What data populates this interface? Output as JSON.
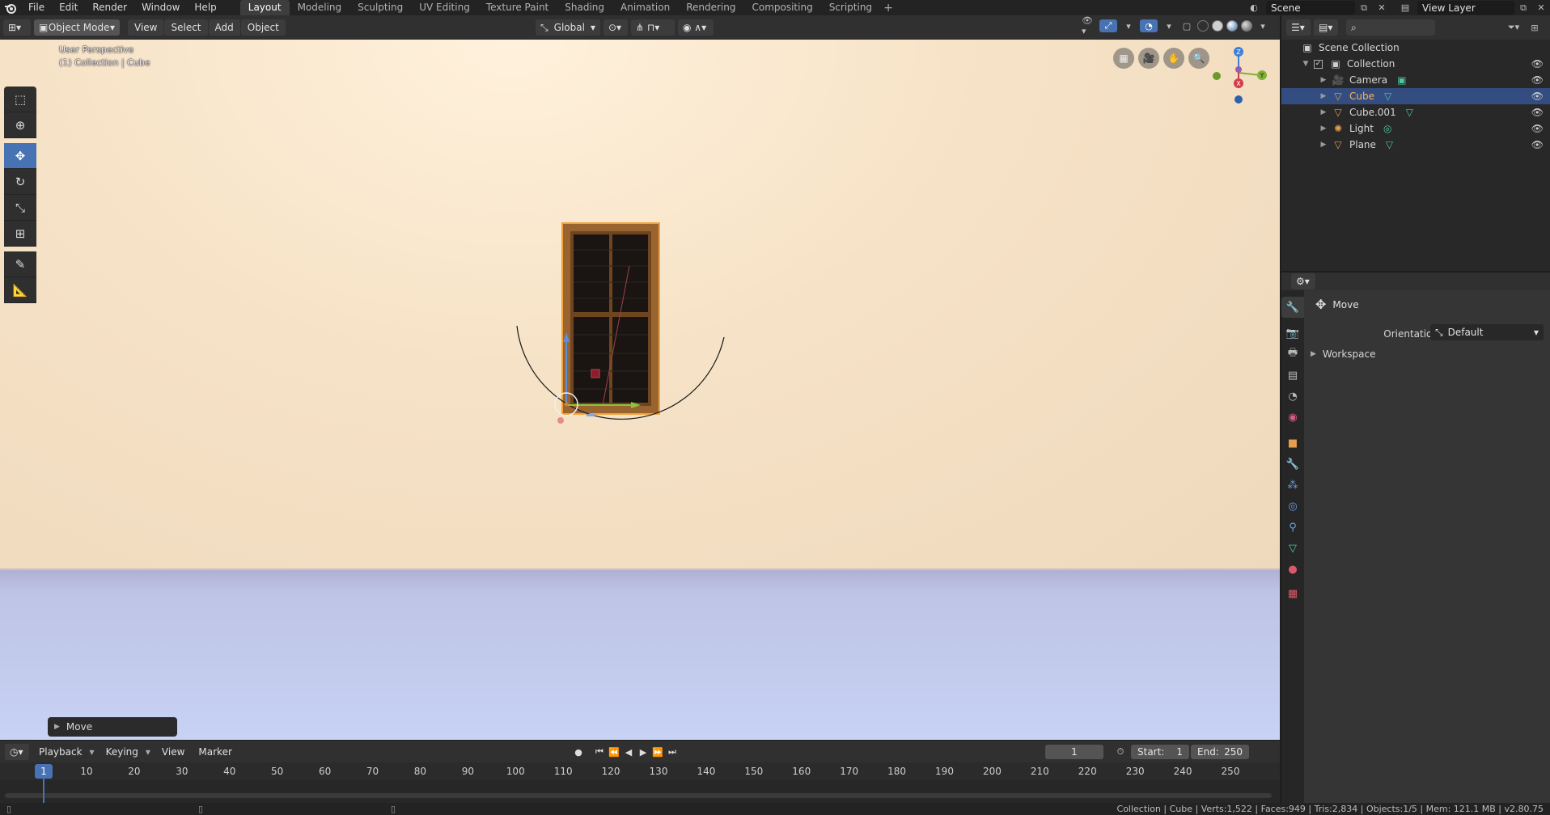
{
  "topbar": {
    "menus": [
      "File",
      "Edit",
      "Render",
      "Window",
      "Help"
    ],
    "workspaces": [
      "Layout",
      "Modeling",
      "Sculpting",
      "UV Editing",
      "Texture Paint",
      "Shading",
      "Animation",
      "Rendering",
      "Compositing",
      "Scripting"
    ],
    "active_workspace": "Layout",
    "add_tab": "+",
    "scene": "Scene",
    "view_layer": "View Layer"
  },
  "viewport_header": {
    "mode": "Object Mode",
    "menus": [
      "View",
      "Select",
      "Add",
      "Object"
    ],
    "transform_orientation": "Global"
  },
  "viewport": {
    "title": "User Perspective",
    "subtitle": "(1) Collection | Cube"
  },
  "operator_panel": {
    "label": "Move"
  },
  "timeline": {
    "menus": [
      "Playback",
      "Keying",
      "View",
      "Marker"
    ],
    "current_frame": "1",
    "start_label": "Start:",
    "start_value": "1",
    "end_label": "End:",
    "end_value": "250",
    "frame_labels": [
      "1",
      "10",
      "20",
      "30",
      "40",
      "50",
      "60",
      "70",
      "80",
      "90",
      "100",
      "110",
      "120",
      "130",
      "140",
      "150",
      "160",
      "170",
      "180",
      "190",
      "200",
      "210",
      "220",
      "230",
      "240",
      "250"
    ]
  },
  "status": {
    "text": "Collection | Cube | Verts:1,522 | Faces:949 | Tris:2,834 | Objects:1/5 | Mem: 121.1 MB | v2.80.75"
  },
  "outliner": {
    "root": "Scene Collection",
    "collection": "Collection",
    "items": [
      {
        "name": "Camera",
        "icon": "camera-icon",
        "color": "#e6a04d"
      },
      {
        "name": "Cube",
        "icon": "mesh-icon",
        "color": "#e6a04d",
        "selected": true
      },
      {
        "name": "Cube.001",
        "icon": "mesh-icon",
        "color": "#e6a04d"
      },
      {
        "name": "Light",
        "icon": "light-icon",
        "color": "#e6a04d"
      },
      {
        "name": "Plane",
        "icon": "mesh-icon",
        "color": "#e6a04d"
      }
    ]
  },
  "properties": {
    "tool_title": "Move",
    "orientation_label": "Orientation",
    "orientation_value": "Default",
    "workspace_label": "Workspace"
  },
  "colors": {
    "accent": "#4772b3",
    "selection": "#334d80",
    "object_orange": "#e6a04d"
  }
}
